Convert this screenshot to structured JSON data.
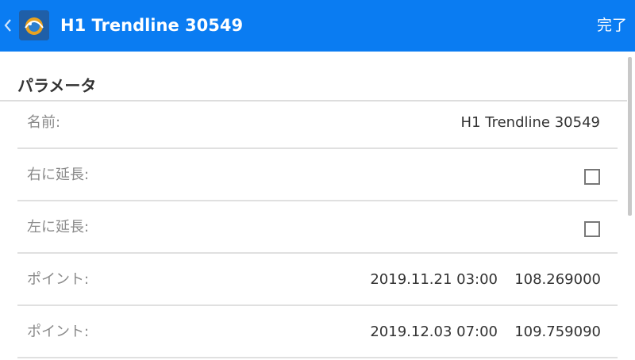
{
  "header": {
    "title": "H1 Trendline 30549",
    "done_label": "完了",
    "background_color": "#0a7cf2"
  },
  "section": {
    "title": "パラメータ"
  },
  "rows": {
    "name": {
      "label": "名前:",
      "value": "H1 Trendline 30549"
    },
    "extend_right": {
      "label": "右に延長:",
      "checked": false
    },
    "extend_left": {
      "label": "左に延長:",
      "checked": false
    },
    "point1": {
      "label": "ポイント:",
      "datetime": "2019.11.21 03:00",
      "price": "108.269000"
    },
    "point2": {
      "label": "ポイント:",
      "datetime": "2019.12.03 07:00",
      "price": "109.759090"
    }
  },
  "icons": {
    "back": "chevron-left-icon",
    "app": "app-logo-icon"
  }
}
